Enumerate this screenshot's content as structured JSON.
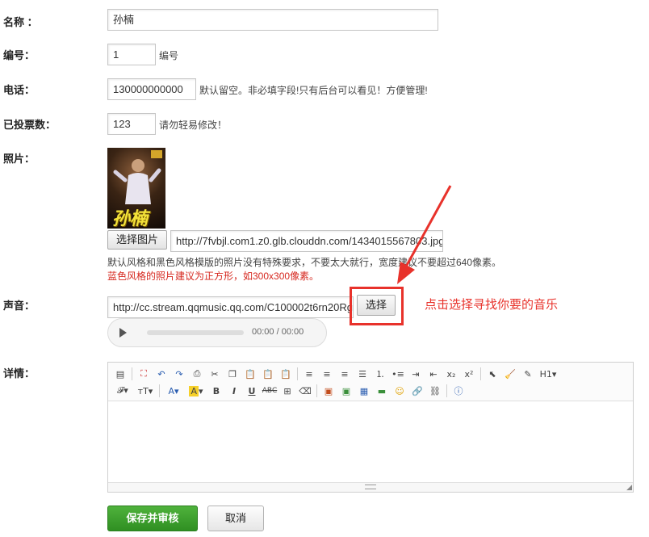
{
  "form": {
    "name": {
      "label": "名称 ：",
      "value": "孙楠"
    },
    "number": {
      "label": "编号：",
      "value": "1",
      "hint": "编号"
    },
    "phone": {
      "label": "电话：",
      "value": "130000000000",
      "hint": "默认留空。非必填字段!只有后台可以看见！方便管理!"
    },
    "votes": {
      "label": "已投票数：",
      "value": "123",
      "hint": "请勿轻易修改！"
    },
    "photo": {
      "label": "照片：",
      "select_button": "选择图片",
      "url": "http://7fvbjl.com1.z0.glb.clouddn.com/1434015567803.jpg",
      "hint": "默认风格和黑色风格模版的照片没有特殊要求，不要太大就行，宽度建议不要超过640像素。",
      "hint_red": "蓝色风格的照片建议为正方形，如300x300像素。",
      "thumb_text": "孙楠"
    },
    "sound": {
      "label": "声音：",
      "url": "http://cc.stream.qqmusic.qq.com/C100002t6rn20Rg",
      "select_button": "选择",
      "player_time": "00:00 / 00:00"
    },
    "detail": {
      "label": "详情：",
      "heading_menu": "H1"
    }
  },
  "annotation": "点击选择寻找你要的音乐",
  "buttons": {
    "save": "保存并审核",
    "cancel": "取消"
  },
  "colors": {
    "accent_red": "#e8322b",
    "save_green": "#3a9e2c"
  }
}
